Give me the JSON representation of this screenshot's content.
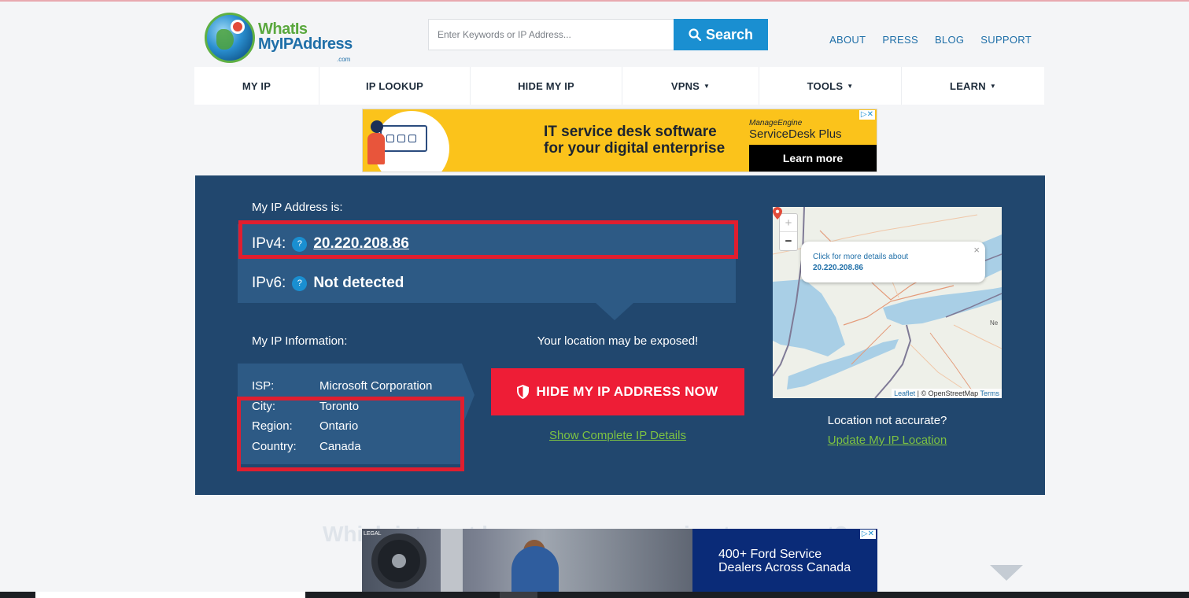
{
  "header": {
    "logo_line1": "WhatIs",
    "logo_line2": "MyIPAddress",
    "logo_line3": ".com",
    "search_placeholder": "Enter Keywords or IP Address...",
    "search_button": "Search",
    "links": [
      "ABOUT",
      "PRESS",
      "BLOG",
      "SUPPORT"
    ]
  },
  "nav": [
    {
      "label": "MY IP",
      "dropdown": false
    },
    {
      "label": "IP LOOKUP",
      "dropdown": false
    },
    {
      "label": "HIDE MY IP",
      "dropdown": false
    },
    {
      "label": "VPNS",
      "dropdown": true
    },
    {
      "label": "TOOLS",
      "dropdown": true
    },
    {
      "label": "LEARN",
      "dropdown": true
    }
  ],
  "ad_top": {
    "headline_1": "IT service desk software",
    "headline_2": "for your digital enterprise",
    "brand_1": "ManageEngine",
    "brand_2": "ServiceDesk Plus",
    "cta": "Learn more"
  },
  "ip_panel": {
    "my_ip_label": "My IP Address is:",
    "ipv4_label": "IPv4:",
    "ipv4_value": "20.220.208.86",
    "ipv6_label": "IPv6:",
    "ipv6_value": "Not detected",
    "help_glyph": "?",
    "info_label": "My IP Information:",
    "info_rows": [
      {
        "key": "ISP:",
        "value": "Microsoft Corporation"
      },
      {
        "key": "City:",
        "value": "Toronto"
      },
      {
        "key": "Region:",
        "value": "Ontario"
      },
      {
        "key": "Country:",
        "value": "Canada"
      }
    ],
    "exposed_text": "Your location may be exposed!",
    "hide_button": "HIDE MY IP ADDRESS NOW",
    "show_details": "Show Complete IP Details",
    "location_not_accurate": "Location not accurate?",
    "update_location": "Update My IP Location"
  },
  "map": {
    "zoom_in": "+",
    "zoom_out": "−",
    "popup_line1": "Click for more details about",
    "popup_line2": "20.220.208.86",
    "popup_close": "×",
    "attribution_leaflet": "Leaflet",
    "attribution_osm": "| © OpenStreetMap",
    "attribution_terms": "Terms",
    "label_ne": "Ne"
  },
  "below": {
    "faded_heading": "Which internet browser are you using to connect?"
  },
  "ad_bottom": {
    "logo": "LEGAL",
    "line1": "400+ Ford Service",
    "line2": "Dealers Across Canada"
  },
  "colors": {
    "panel_bg": "#21476e",
    "row_bg": "#2d5a85",
    "accent_blue": "#1a8fd1",
    "highlight_red": "#e01e2f",
    "cta_red": "#ee1d36",
    "link_green": "#7dc242"
  }
}
